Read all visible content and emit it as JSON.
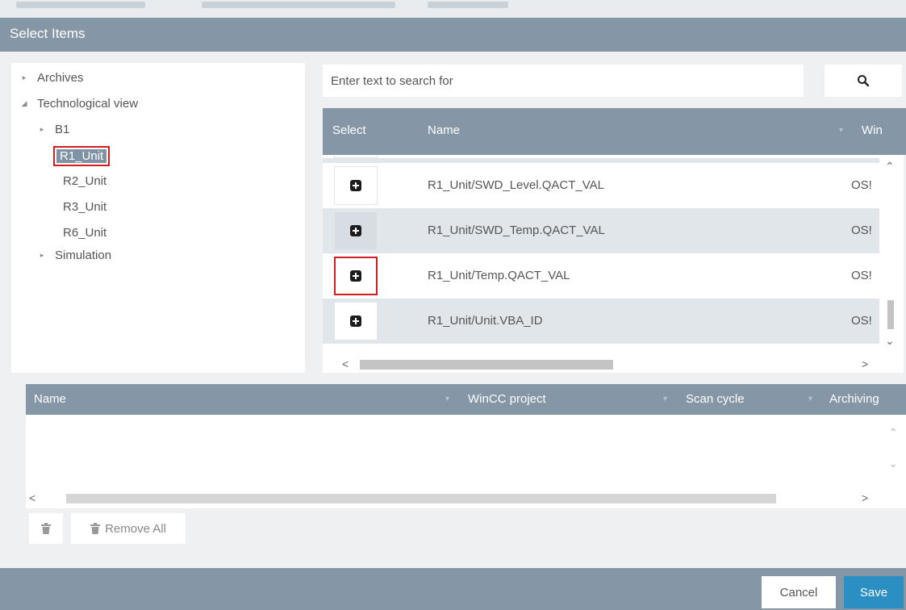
{
  "dialog": {
    "title": "Select Items"
  },
  "tree": {
    "items": [
      {
        "label": "Archives",
        "expander": "collapsed"
      },
      {
        "label": "Technological view",
        "expander": "expanded"
      },
      {
        "label": "B1",
        "expander": "collapsed"
      },
      {
        "label": "R1_Unit",
        "selected": true
      },
      {
        "label": "R2_Unit"
      },
      {
        "label": "R3_Unit"
      },
      {
        "label": "R6_Unit"
      },
      {
        "label": "Simulation",
        "expander": "collapsed"
      }
    ]
  },
  "search": {
    "placeholder": "Enter text to search for",
    "icon": "search-icon"
  },
  "grid": {
    "columns": [
      "Select",
      "Name",
      "Win"
    ],
    "rows": [
      {
        "name": "R1_Unit/SWD_Level.QACT_VAL",
        "win": "OS!"
      },
      {
        "name": "R1_Unit/SWD_Temp.QACT_VAL",
        "win": "OS!"
      },
      {
        "name": "R1_Unit/Temp.QACT_VAL",
        "win": "OS!"
      },
      {
        "name": "R1_Unit/Unit.VBA_ID",
        "win": "OS!"
      }
    ]
  },
  "selected_grid": {
    "columns": [
      "Name",
      "WinCC project",
      "Scan cycle",
      "Archiving"
    ]
  },
  "actions": {
    "remove_all": "Remove All"
  },
  "footer": {
    "cancel": "Cancel",
    "save": "Save"
  },
  "colors": {
    "header": "#8597a7",
    "accent": "#2b8fc4",
    "highlight": "#d11c22"
  }
}
